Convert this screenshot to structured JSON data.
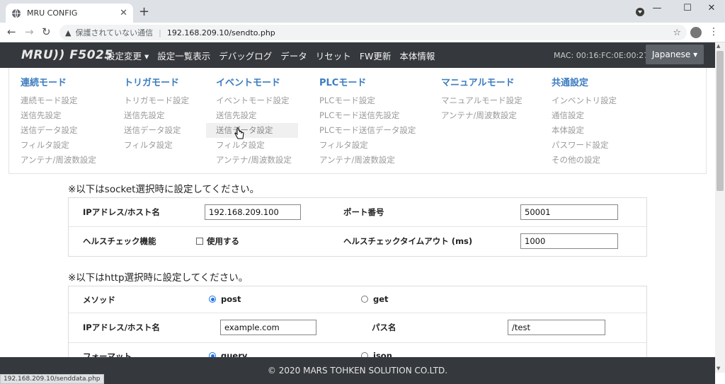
{
  "browser": {
    "tab_title": "MRU CONFIG",
    "new_tab": "+",
    "close": "✕",
    "insecure_label": "保護されていない通信",
    "url": "192.168.209.10/sendto.php",
    "status_url": "192.168.209.10/senddata.php"
  },
  "nav": {
    "logo": "MRU)) F5025",
    "items": [
      {
        "label": "設定変更 ▾"
      },
      {
        "label": "設定一覧表示"
      },
      {
        "label": "デバッグログ"
      },
      {
        "label": "データ"
      },
      {
        "label": "リセット"
      },
      {
        "label": "FW更新"
      },
      {
        "label": "本体情報"
      }
    ],
    "mac": "MAC: 00:16:FC:0E:00:27",
    "language": "Japanese ▾"
  },
  "mega_menu": {
    "columns": [
      {
        "head": "連続モード",
        "items": [
          "連続モード設定",
          "送信先設定",
          "送信データ設定",
          "フィルタ設定",
          "アンテナ/周波数設定"
        ]
      },
      {
        "head": "トリガモード",
        "items": [
          "トリガモード設定",
          "送信先設定",
          "送信データ設定",
          "フィルタ設定"
        ]
      },
      {
        "head": "イベントモード",
        "items": [
          "イベントモード設定",
          "送信先設定",
          "送信データ設定",
          "フィルタ設定",
          "アンテナ/周波数設定"
        ]
      },
      {
        "head": "PLCモード",
        "items": [
          "PLCモード設定",
          "PLCモード送信先設定",
          "PLCモード送信データ設定",
          "フィルタ設定",
          "アンテナ/周波数設定"
        ]
      },
      {
        "head": "マニュアルモード",
        "items": [
          "マニュアルモード設定",
          "アンテナ/周波数設定"
        ]
      },
      {
        "head": "共通設定",
        "items": [
          "インベントリ設定",
          "通信設定",
          "本体設定",
          "パスワード設定",
          "その他の設定"
        ]
      }
    ]
  },
  "socket_section": {
    "title": "※以下はsocket選択時に設定してください。",
    "ip_label": "IPアドレス/ホスト名",
    "ip_value": "192.168.209.100",
    "port_label": "ポート番号",
    "port_value": "50001",
    "health_label": "ヘルスチェック機能",
    "health_checkbox": "使用する",
    "timeout_label": "ヘルスチェックタイムアウト (ms)",
    "timeout_value": "1000"
  },
  "http_section": {
    "title": "※以下はhttp選択時に設定してください。",
    "method_label": "メソッド",
    "method_post": "post",
    "method_get": "get",
    "ip_label": "IPアドレス/ホスト名",
    "ip_value": "example.com",
    "path_label": "パス名",
    "path_value": "/test",
    "format_label": "フォーマット",
    "format_query": "query",
    "format_json": "json"
  },
  "footer": "© 2020 MARS TOHKEN SOLUTION CO.LTD."
}
